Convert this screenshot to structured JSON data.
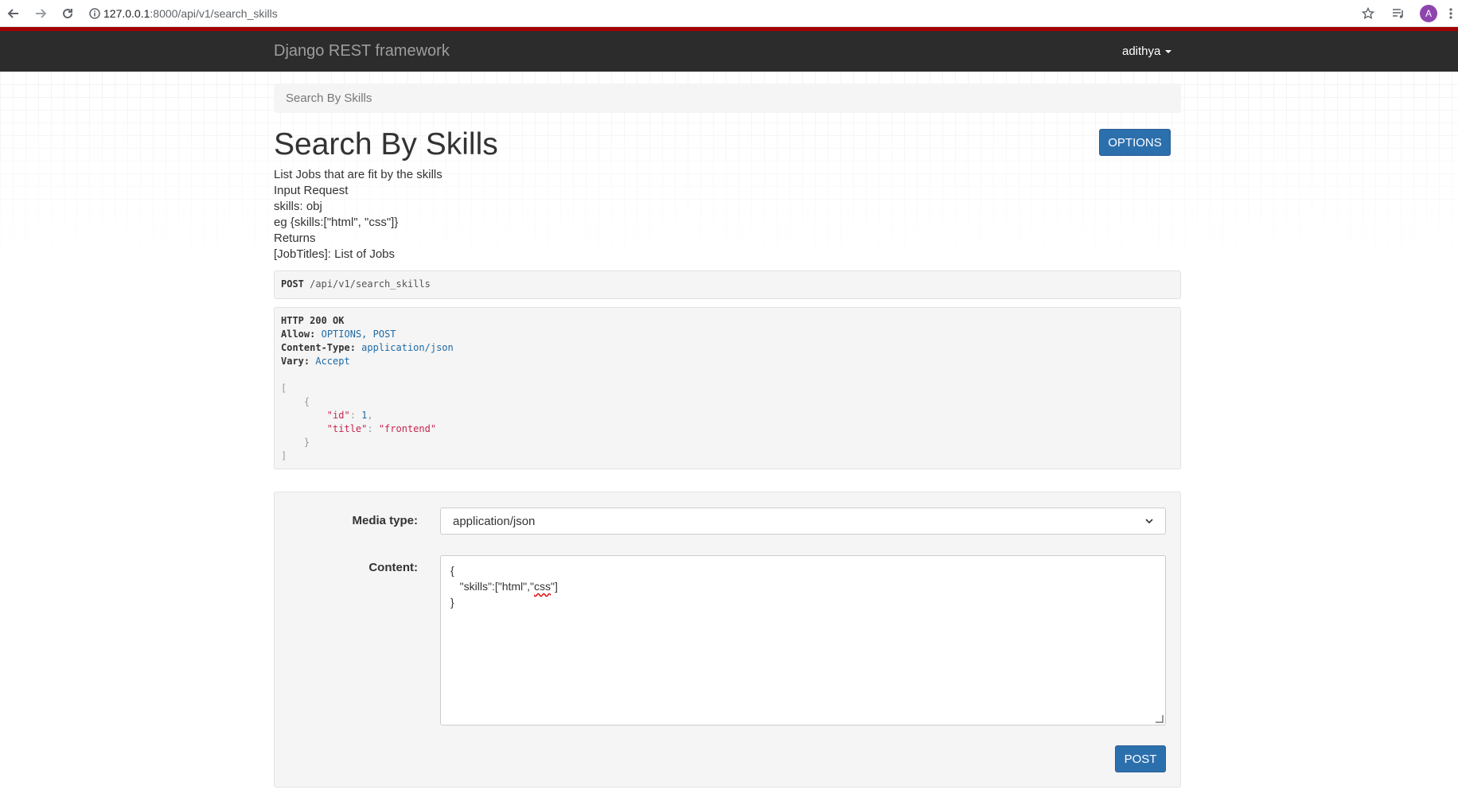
{
  "browser": {
    "url_host": "127.0.0.1",
    "url_path": ":8000/api/v1/search_skills",
    "avatar_letter": "A"
  },
  "navbar": {
    "brand": "Django REST framework",
    "user": "adithya"
  },
  "breadcrumb": "Search By Skills",
  "page": {
    "title": "Search By Skills",
    "options_label": "OPTIONS",
    "description": [
      "List Jobs that are fit by the skills",
      "Input Request",
      "skills: obj",
      "eg {skills:[\"html\", \"css\"]}",
      "Returns",
      "[JobTitles]: List of Jobs"
    ]
  },
  "request": {
    "method": "POST",
    "url": "/api/v1/search_skills"
  },
  "response": {
    "status": "HTTP 200 OK",
    "headers": [
      {
        "name": "Allow:",
        "value": "OPTIONS, POST"
      },
      {
        "name": "Content-Type:",
        "value": "application/json"
      },
      {
        "name": "Vary:",
        "value": "Accept"
      }
    ],
    "body": {
      "id_key": "\"id\"",
      "id_value": "1",
      "title_key": "\"title\"",
      "title_value": "\"frontend\""
    }
  },
  "form": {
    "media_type_label": "Media type:",
    "media_type_value": "application/json",
    "content_label": "Content:",
    "content_line1": "{",
    "content_line2_prefix": "   \"skills\":[\"html\",\"",
    "content_line2_word": "css",
    "content_line2_suffix": "\"]",
    "content_line3": "}",
    "post_label": "POST"
  },
  "colors": {
    "navbar_bg": "#2c2c2c",
    "navbar_accent": "#a30000",
    "button_blue": "#2c6fad"
  }
}
